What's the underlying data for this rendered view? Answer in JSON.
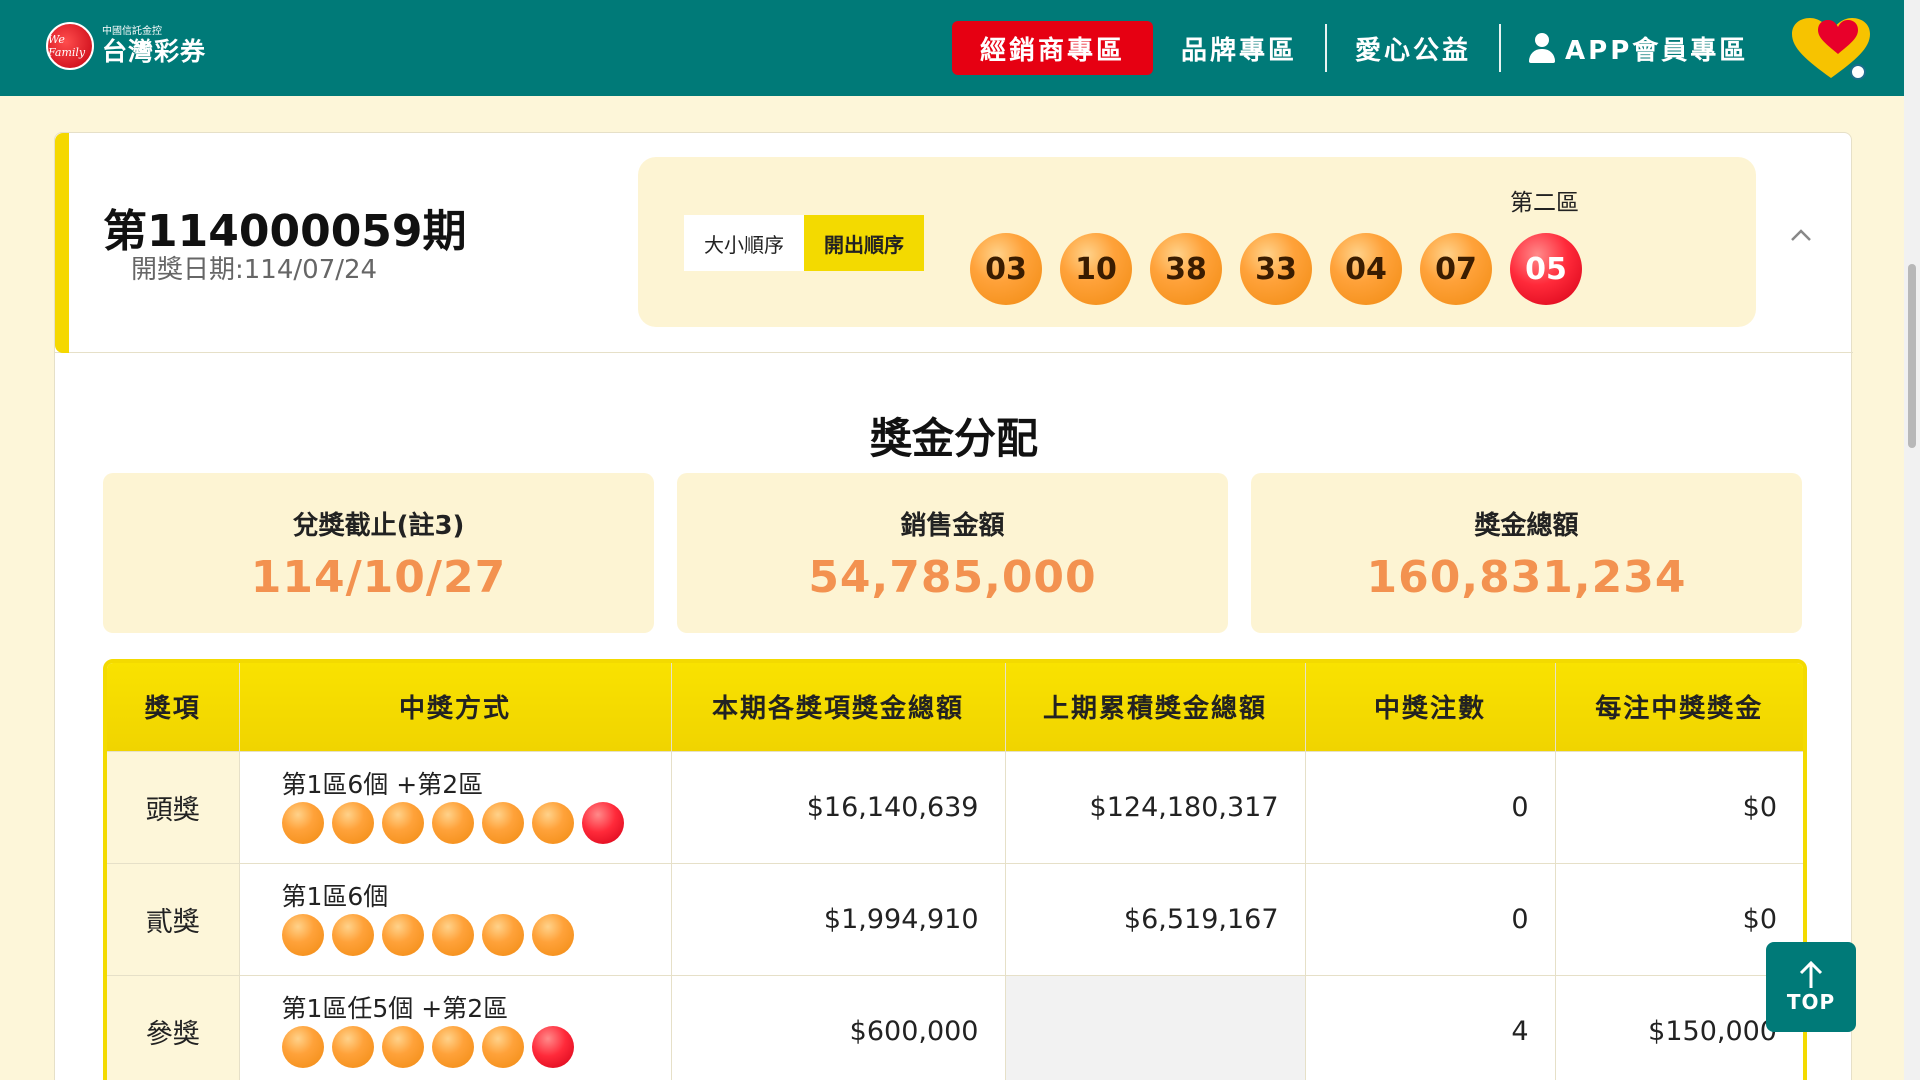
{
  "header": {
    "logo_small": "中國信託金控",
    "logo_big": "台灣彩券",
    "logo_emblem": "We Family",
    "nav": {
      "dealer": "經銷商專區",
      "brand": "品牌專區",
      "charity": "愛心公益",
      "app": "APP會員專區"
    }
  },
  "draw": {
    "number": "第114000059期",
    "date": "開獎日期:114/07/24",
    "order_size": "大小順序",
    "order_drawn": "開出順序",
    "zone2_label": "第二區",
    "balls": [
      "03",
      "10",
      "38",
      "33",
      "04",
      "07"
    ],
    "special_ball": "05"
  },
  "section_title": "獎金分配",
  "stats": [
    {
      "label": "兌獎截止(註3)",
      "value": "114/10/27"
    },
    {
      "label": "銷售金額",
      "value": "54,785,000"
    },
    {
      "label": "獎金總額",
      "value": "160,831,234"
    }
  ],
  "table": {
    "headers": [
      "獎項",
      "中獎方式",
      "本期各獎項獎金總額",
      "上期累積獎金總額",
      "中獎注數",
      "每注中獎獎金"
    ],
    "rows": [
      {
        "prize": "頭獎",
        "method": "第1區6個 +第2區",
        "orange": 6,
        "red": 1,
        "total": "$16,140,639",
        "carry": "$124,180,317",
        "count": "0",
        "each": "$0"
      },
      {
        "prize": "貳獎",
        "method": "第1區6個",
        "orange": 6,
        "red": 0,
        "total": "$1,994,910",
        "carry": "$6,519,167",
        "count": "0",
        "each": "$0"
      },
      {
        "prize": "參獎",
        "method": "第1區任5個 +第2區",
        "orange": 5,
        "red": 1,
        "total": "$600,000",
        "carry": "",
        "count": "4",
        "each": "$150,000"
      }
    ]
  },
  "top_button": "TOP",
  "colors": {
    "header_bg": "#007a78",
    "dealer_btn": "#e60012",
    "accent_yellow": "#f3da00",
    "stat_value": "#f39250"
  }
}
